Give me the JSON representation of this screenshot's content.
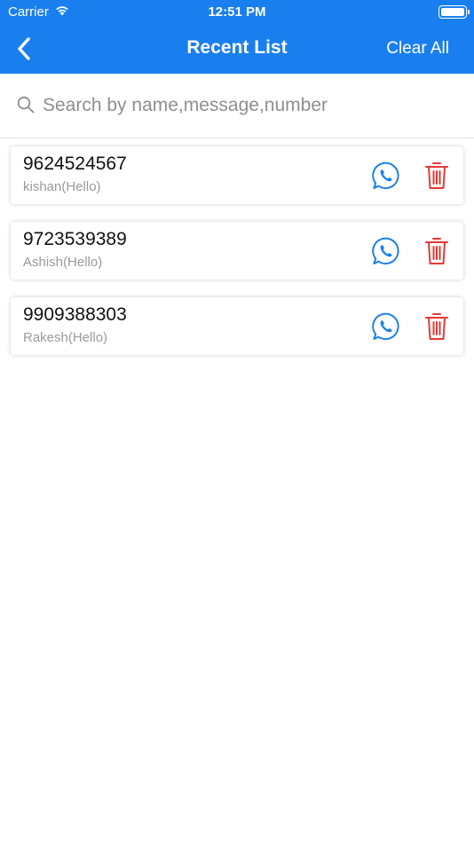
{
  "status_bar": {
    "carrier": "Carrier",
    "time": "12:51 PM"
  },
  "nav": {
    "title": "Recent List",
    "clear_label": "Clear All",
    "back_icon": "chevron-left-icon"
  },
  "search": {
    "placeholder": "Search by name,message,number",
    "value": ""
  },
  "recent": [
    {
      "number": "9624524567",
      "message": "kishan(Hello)"
    },
    {
      "number": "9723539389",
      "message": "Ashish(Hello)"
    },
    {
      "number": "9909388303",
      "message": "Rakesh(Hello)"
    }
  ],
  "colors": {
    "header": "#1a7fee",
    "whatsapp_icon": "#1a7fee",
    "delete_icon": "#e53935"
  }
}
